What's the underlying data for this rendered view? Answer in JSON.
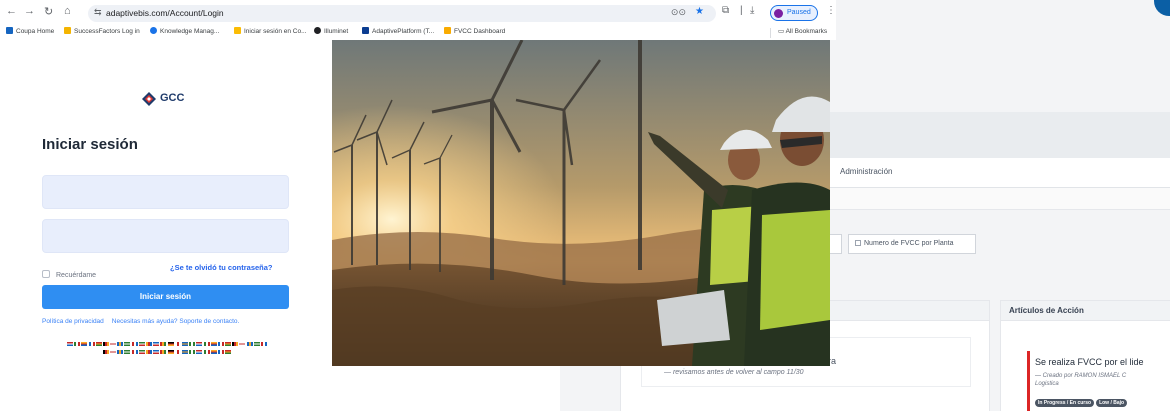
{
  "browser": {
    "url": "adaptivebis.com/Account/Login",
    "profile_status": "Paused",
    "bookmarks": [
      {
        "label": "Coupa Home",
        "color": "#1565c0"
      },
      {
        "label": "SuccessFactors Log in",
        "color": "#f4b400"
      },
      {
        "label": "Knowledge Manag...",
        "color": "#1a73e8"
      },
      {
        "label": "Iniciar sesión en Co...",
        "color": "#fbbc04"
      },
      {
        "label": "Illuminet",
        "color": "#202124"
      },
      {
        "label": "AdaptivePlatform (T...",
        "color": "#0b3d91"
      },
      {
        "label": "FVCC Dashboard",
        "color": "#f9ab00"
      }
    ],
    "all_bookmarks_label": "All Bookmarks"
  },
  "login": {
    "brand": "GCC",
    "title": "Iniciar sesión",
    "username_value": "",
    "password_value": "",
    "remember_label": "Recuérdame",
    "forgot_label": "¿Se te olvidó tu contraseña?",
    "submit_label": "Iniciar sesión",
    "footer_links": [
      "Política de privacidad",
      "Necesitas más ayuda? Soporte de contacto."
    ],
    "brand_color": "#1f3b6b",
    "accent_color": "#2f8ef2"
  },
  "background_app": {
    "nav_item": "Administración",
    "tab_partial": "o",
    "tab_label": "Numero de FVCC por Planta",
    "left_item_fragment": "ra",
    "left_item_note": "— revisamos antes de volver al campo 11/30",
    "right_card_title": "Artículos de Acción",
    "action_title": "Se realiza FVCC por el lide",
    "action_meta": "— Creado por RAMON ISMAEL C",
    "action_meta2": "Logistica",
    "tags": [
      "In Progress / En curso",
      "Low / Bajo"
    ]
  }
}
